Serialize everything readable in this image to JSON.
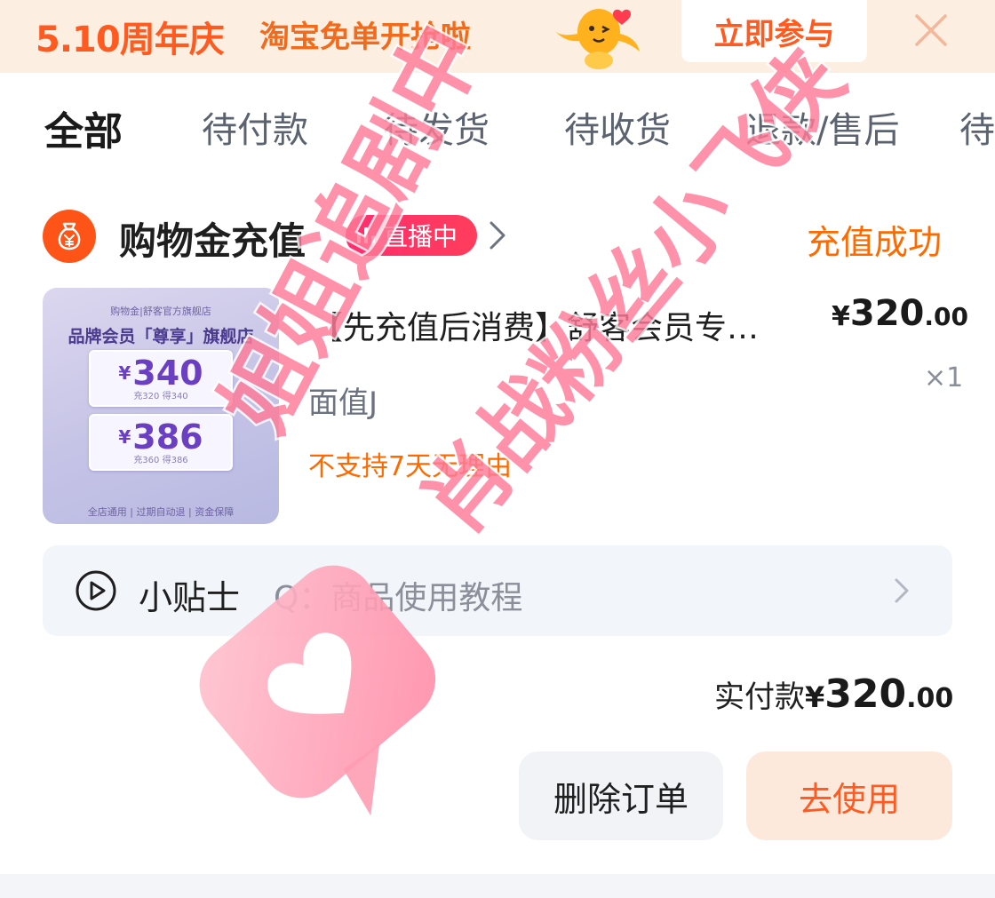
{
  "banner": {
    "anniversary": "5.10周年庆",
    "slogan": "淘宝免单开抢啦",
    "join_label": "立即参与"
  },
  "tabs": [
    {
      "label": "全部",
      "active": true
    },
    {
      "label": "待付款"
    },
    {
      "label": "待发货"
    },
    {
      "label": "待收货"
    },
    {
      "label": "退款/售后"
    },
    {
      "label": "待"
    }
  ],
  "shop": {
    "name": "购物金充值",
    "live_badge": "直播中",
    "status": "充值成功"
  },
  "product": {
    "title": "【先充值后消费】舒客会员专…",
    "price": {
      "yen": "¥",
      "int": "320",
      "dec": ".00"
    },
    "quantity": "×1",
    "spec": "面值J",
    "note": "不支持7天无理由",
    "image": {
      "shop_line": "购物金|舒客官方旗舰店",
      "headline": "品牌会员「尊享」旗舰店",
      "cards": [
        {
          "yen": "¥",
          "value": "340",
          "sub": "充320 得340"
        },
        {
          "yen": "¥",
          "value": "386",
          "sub": "充360 得386"
        }
      ],
      "footer": "全店通用 | 过期自动退 | 资金保障"
    }
  },
  "tips": {
    "label": "小贴士",
    "text": "Q：商品使用教程"
  },
  "total": {
    "label": "实付款",
    "yen": "¥",
    "int": "320",
    "dec": ".00"
  },
  "actions": {
    "delete_label": "删除订单",
    "use_label": "去使用"
  },
  "watermark": {
    "line1": "姐姐追剧中",
    "line2": "肖战粉丝小飞侠"
  },
  "colors": {
    "accent": "#ff5a1f",
    "status_orange": "#ff6a00",
    "live_pink": "#ff2d6f",
    "banner_bg": "#fdeee2",
    "watermark_pink": "#ff7b98"
  }
}
